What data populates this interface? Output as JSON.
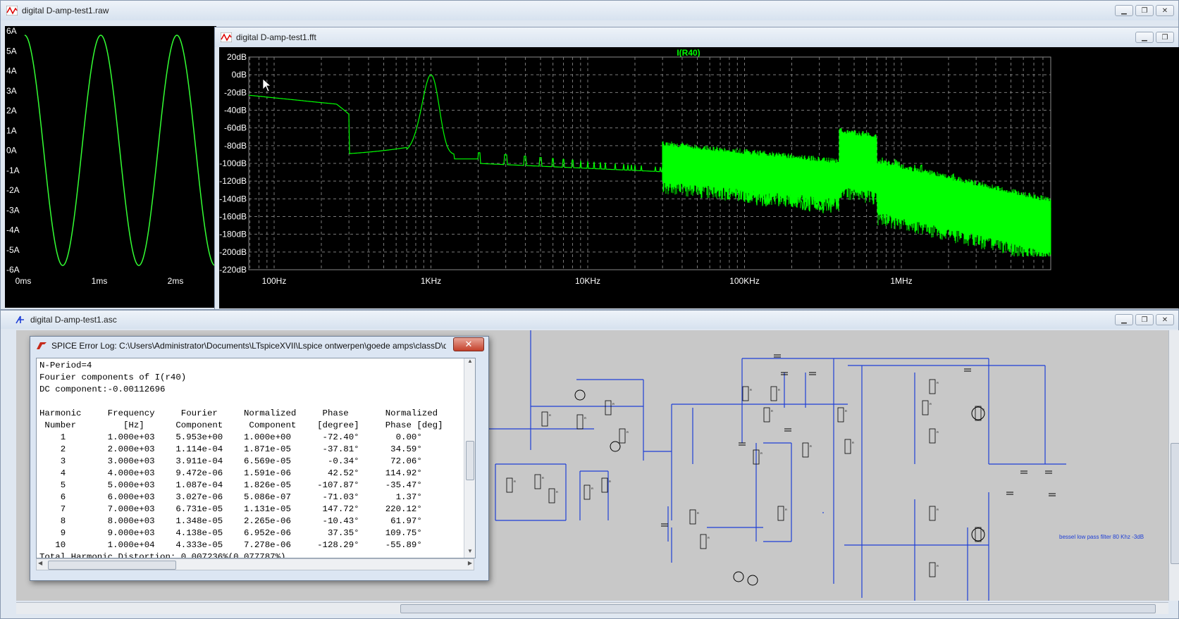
{
  "raw_window": {
    "title": "digital D-amp-test1.raw",
    "y_ticks": [
      "6A",
      "5A",
      "4A",
      "3A",
      "2A",
      "1A",
      "0A",
      "-1A",
      "-2A",
      "-3A",
      "-4A",
      "-5A",
      "-6A"
    ],
    "x_ticks": [
      "0ms",
      "1ms",
      "2ms"
    ]
  },
  "fft_window": {
    "title": "digital D-amp-test1.fft",
    "trace_label": "I(R40)",
    "y_ticks": [
      "20dB",
      "0dB",
      "-20dB",
      "-40dB",
      "-60dB",
      "-80dB",
      "-100dB",
      "-120dB",
      "-140dB",
      "-160dB",
      "-180dB",
      "-200dB",
      "-220dB"
    ],
    "x_ticks": [
      "100Hz",
      "1KHz",
      "10KHz",
      "100KHz",
      "1MHz"
    ]
  },
  "asc_window": {
    "title": "digital D-amp-test1.asc",
    "filter_note": "bessel low pass filter 80 Khz -3dB"
  },
  "error_log": {
    "title": "SPICE Error Log: C:\\Users\\Administrator\\Documents\\LTspiceXVII\\Lspice ontwerpen\\goede amps\\classD\\d...",
    "close_label": "✕",
    "lines": [
      "N-Period=4",
      "Fourier components of I(r40)",
      "DC component:-0.00112696",
      "",
      "Harmonic     Frequency     Fourier     Normalized     Phase       Normalized",
      " Number         [Hz]      Component     Component    [degree]     Phase [deg]",
      "    1        1.000e+03    5.953e+00    1.000e+00      -72.40°       0.00°",
      "    2        2.000e+03    1.114e-04    1.871e-05      -37.81°      34.59°",
      "    3        3.000e+03    3.911e-04    6.569e-05       -0.34°      72.06°",
      "    4        4.000e+03    9.472e-06    1.591e-06       42.52°     114.92°",
      "    5        5.000e+03    1.087e-04    1.826e-05     -107.87°     -35.47°",
      "    6        6.000e+03    3.027e-06    5.086e-07      -71.03°       1.37°",
      "    7        7.000e+03    6.731e-05    1.131e-05      147.72°     220.12°",
      "    8        8.000e+03    1.348e-05    2.265e-06      -10.43°      61.97°",
      "    9        9.000e+03    4.138e-05    6.952e-06       37.35°     109.75°",
      "   10        1.000e+04    4.333e-05    7.278e-06     -128.29°     -55.89°",
      "Total Harmonic Distortion: 0.007236%(0.077787%)"
    ]
  },
  "colors": {
    "trace": "#00ff00",
    "trace_raw": "#33ff33",
    "grid": "#8a8a8a",
    "wire": "#1f3fd6",
    "schematic_bg": "#c8c8c8"
  },
  "icons": [
    "waveform-icon",
    "schematic-icon",
    "ltspice-icon",
    "minimize-icon",
    "maximize-icon",
    "close-icon"
  ]
}
